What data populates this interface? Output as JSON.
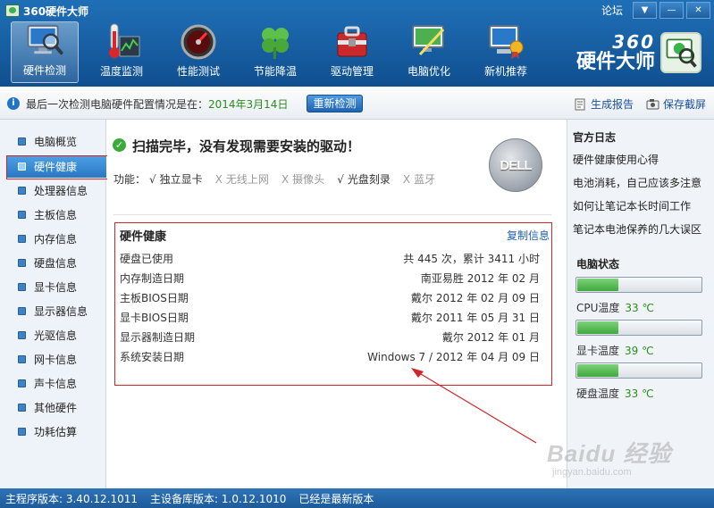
{
  "app": {
    "title": "360硬件大师",
    "forum": "论坛"
  },
  "window_controls": {
    "dropdown": "▼",
    "minimize": "—",
    "close": "✕"
  },
  "toolbar": [
    {
      "label": "硬件检测",
      "icon": "monitor-magnifier-icon",
      "active": true
    },
    {
      "label": "温度监测",
      "icon": "thermometer-icon",
      "active": false
    },
    {
      "label": "性能测试",
      "icon": "speedometer-icon",
      "active": false
    },
    {
      "label": "节能降温",
      "icon": "clover-icon",
      "active": false
    },
    {
      "label": "驱动管理",
      "icon": "toolbox-icon",
      "active": false
    },
    {
      "label": "电脑优化",
      "icon": "monitor-broom-icon",
      "active": false
    },
    {
      "label": "新机推荐",
      "icon": "computer-badge-icon",
      "active": false
    }
  ],
  "brand": {
    "number": "360",
    "name": "硬件大师"
  },
  "infobar": {
    "text": "最后一次检测电脑硬件配置情况是在：",
    "date": "2014年3月14日",
    "recheck": "重新检测",
    "report": "生成报告",
    "screenshot": "保存截屏"
  },
  "sidebar": {
    "items": [
      {
        "label": "电脑概览"
      },
      {
        "label": "硬件健康"
      },
      {
        "label": "处理器信息"
      },
      {
        "label": "主板信息"
      },
      {
        "label": "内存信息"
      },
      {
        "label": "硬盘信息"
      },
      {
        "label": "显卡信息"
      },
      {
        "label": "显示器信息"
      },
      {
        "label": "光驱信息"
      },
      {
        "label": "网卡信息"
      },
      {
        "label": "声卡信息"
      },
      {
        "label": "其他硬件"
      },
      {
        "label": "功耗估算"
      }
    ],
    "active_index": 1
  },
  "scan": {
    "title": "扫描完毕，没有发现需要安装的驱动！",
    "func_label": "功能：",
    "features": [
      {
        "mark": "√",
        "label": "独立显卡",
        "enabled": true
      },
      {
        "mark": "X",
        "label": "无线上网",
        "enabled": false
      },
      {
        "mark": "X",
        "label": "摄像头",
        "enabled": false
      },
      {
        "mark": "√",
        "label": "光盘刻录",
        "enabled": true
      },
      {
        "mark": "X",
        "label": "蓝牙",
        "enabled": false
      }
    ],
    "logo_text": "DELL"
  },
  "health": {
    "title": "硬件健康",
    "copy": "复制信息",
    "rows": [
      {
        "key": "硬盘已使用",
        "value": "共 445 次，累计 3411 小时"
      },
      {
        "key": "内存制造日期",
        "value": "南亚易胜 2012 年 02 月"
      },
      {
        "key": "主板BIOS日期",
        "value": "戴尔 2012 年 02 月 09 日"
      },
      {
        "key": "显卡BIOS日期",
        "value": "戴尔 2011 年 05 月 31 日"
      },
      {
        "key": "显示器制造日期",
        "value": "戴尔 2012 年 01 月"
      },
      {
        "key": "系统安装日期",
        "value": "Windows 7 / 2012 年 04 月 09 日"
      }
    ]
  },
  "rightbar": {
    "official_title": "官方日志",
    "logs": [
      "硬件健康使用心得",
      "电池消耗，自己应该多注意",
      "如何让笔记本长时间工作",
      "笔记本电池保养的几大误区"
    ],
    "status_title": "电脑状态",
    "temps": [
      {
        "label": "CPU温度",
        "value": "33 ℃",
        "level": 0.33
      },
      {
        "label": "显卡温度",
        "value": "39 ℃",
        "level": 0.33
      },
      {
        "label": "硬盘温度",
        "value": "33 ℃",
        "level": 0.33
      }
    ]
  },
  "statusbar": {
    "main_version": "主程序版本: 3.40.12.1011",
    "db_version": "主设备库版本: 1.0.12.1010",
    "latest": "已经是最新版本"
  },
  "watermark": {
    "brand": "Bai",
    "paw": "du",
    "suffix": "经验",
    "url": "jingyan.baidu.com"
  },
  "colors": {
    "header": "#1a63a8",
    "accent_green": "#2c8b1d",
    "link_blue": "#1d5fb4",
    "highlight_red": "#d0262b"
  }
}
